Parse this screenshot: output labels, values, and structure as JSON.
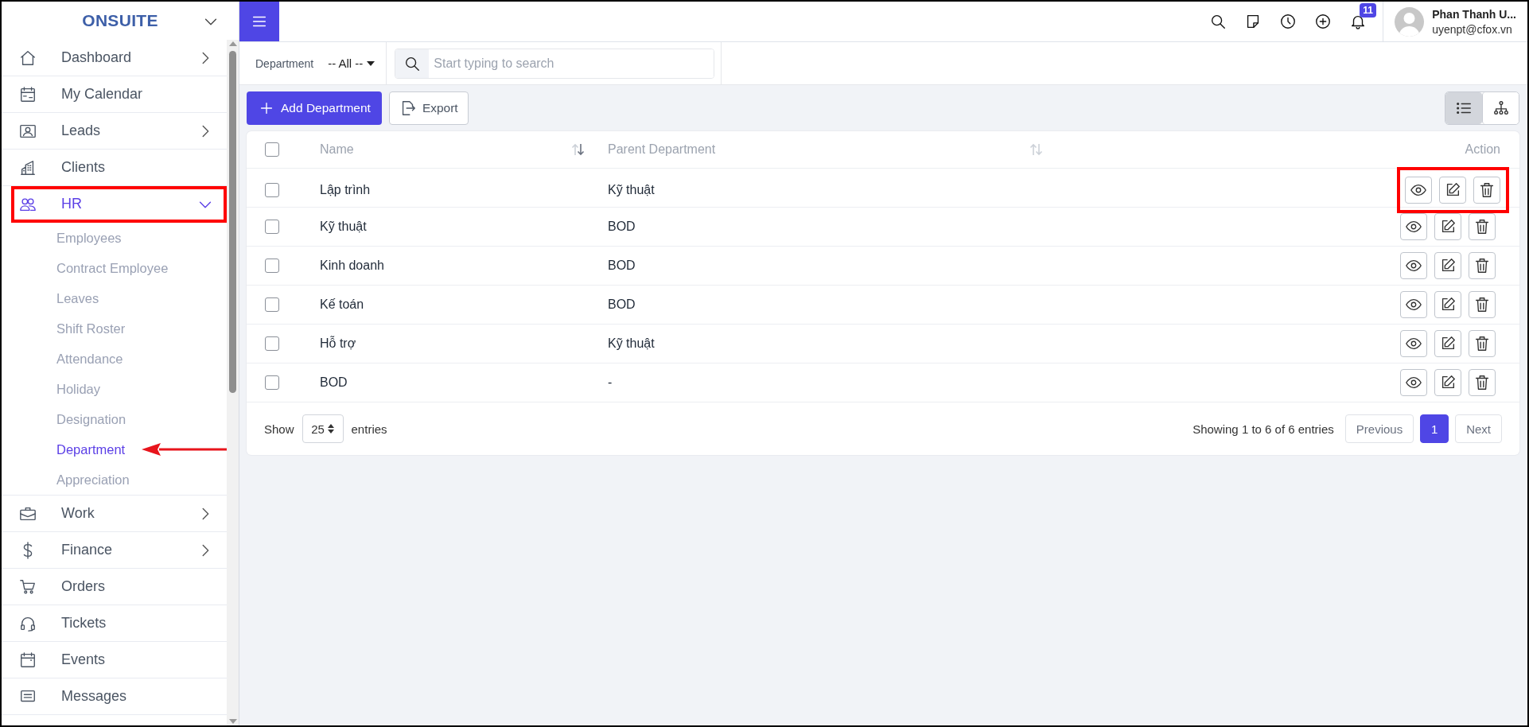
{
  "brand": {
    "name": "ONSUITE"
  },
  "sidebar": {
    "items": [
      {
        "label": "Dashboard",
        "expandable": true,
        "expanded": false,
        "selected": false,
        "highlighted": false
      },
      {
        "label": "My Calendar",
        "expandable": false,
        "selected": false,
        "highlighted": false
      },
      {
        "label": "Leads",
        "expandable": true,
        "expanded": false,
        "selected": false,
        "highlighted": false
      },
      {
        "label": "Clients",
        "expandable": false,
        "selected": false,
        "highlighted": false
      },
      {
        "label": "HR",
        "expandable": true,
        "expanded": true,
        "selected": true,
        "highlighted": true,
        "children": [
          {
            "label": "Employees",
            "selected": false,
            "pointer_arrow": false
          },
          {
            "label": "Contract Employee",
            "selected": false,
            "pointer_arrow": false
          },
          {
            "label": "Leaves",
            "selected": false,
            "pointer_arrow": false
          },
          {
            "label": "Shift Roster",
            "selected": false,
            "pointer_arrow": false
          },
          {
            "label": "Attendance",
            "selected": false,
            "pointer_arrow": false
          },
          {
            "label": "Holiday",
            "selected": false,
            "pointer_arrow": false
          },
          {
            "label": "Designation",
            "selected": false,
            "pointer_arrow": false
          },
          {
            "label": "Department",
            "selected": true,
            "pointer_arrow": true
          },
          {
            "label": "Appreciation",
            "selected": false,
            "pointer_arrow": false
          }
        ]
      },
      {
        "label": "Work",
        "expandable": true,
        "expanded": false,
        "selected": false,
        "highlighted": false
      },
      {
        "label": "Finance",
        "expandable": true,
        "expanded": false,
        "selected": false,
        "highlighted": false
      },
      {
        "label": "Orders",
        "expandable": false,
        "selected": false,
        "highlighted": false
      },
      {
        "label": "Tickets",
        "expandable": false,
        "selected": false,
        "highlighted": false
      },
      {
        "label": "Events",
        "expandable": false,
        "selected": false,
        "highlighted": false
      },
      {
        "label": "Messages",
        "expandable": false,
        "selected": false,
        "highlighted": false
      }
    ]
  },
  "topbar": {
    "notifications_badge": "11",
    "user": {
      "name": "Phan Thanh U...",
      "email": "uyenpt@cfox.vn"
    }
  },
  "filters": {
    "label": "Department",
    "value": "-- All --",
    "search": {
      "placeholder": "Start typing to search"
    }
  },
  "toolbar": {
    "buttons": [
      {
        "label": "Add Department",
        "kind": "primary"
      },
      {
        "label": "Export",
        "kind": "secondary"
      }
    ],
    "views": [
      {
        "selected": true
      },
      {
        "selected": false
      }
    ]
  },
  "table": {
    "select_all": {
      "checked": false
    },
    "columns": [
      {
        "label": "Name",
        "sortable": true,
        "sorted": true
      },
      {
        "label": "Parent Department",
        "sortable": true,
        "sorted": false
      },
      {
        "label": "Action",
        "sortable": false
      }
    ],
    "rows": [
      {
        "checked": false,
        "name": "Lập trình",
        "parent": "Kỹ thuật",
        "highlighted": true
      },
      {
        "checked": false,
        "name": "Kỹ thuật",
        "parent": "BOD",
        "highlighted": false
      },
      {
        "checked": false,
        "name": "Kinh doanh",
        "parent": "BOD",
        "highlighted": false
      },
      {
        "checked": false,
        "name": "Kế toán",
        "parent": "BOD",
        "highlighted": false
      },
      {
        "checked": false,
        "name": "Hỗ trợ",
        "parent": "Kỹ thuật",
        "highlighted": false
      },
      {
        "checked": false,
        "name": "BOD",
        "parent": "-",
        "highlighted": false
      }
    ]
  },
  "footer": {
    "show_label": "Show",
    "page_size": "25",
    "entries_label": "entries",
    "info": "Showing 1 to 6 of 6 entries",
    "pagination": [
      {
        "label": "Previous",
        "kind": "nav",
        "selected": false
      },
      {
        "label": "1",
        "kind": "page",
        "selected": true
      },
      {
        "label": "Next",
        "kind": "nav",
        "selected": false
      }
    ]
  }
}
